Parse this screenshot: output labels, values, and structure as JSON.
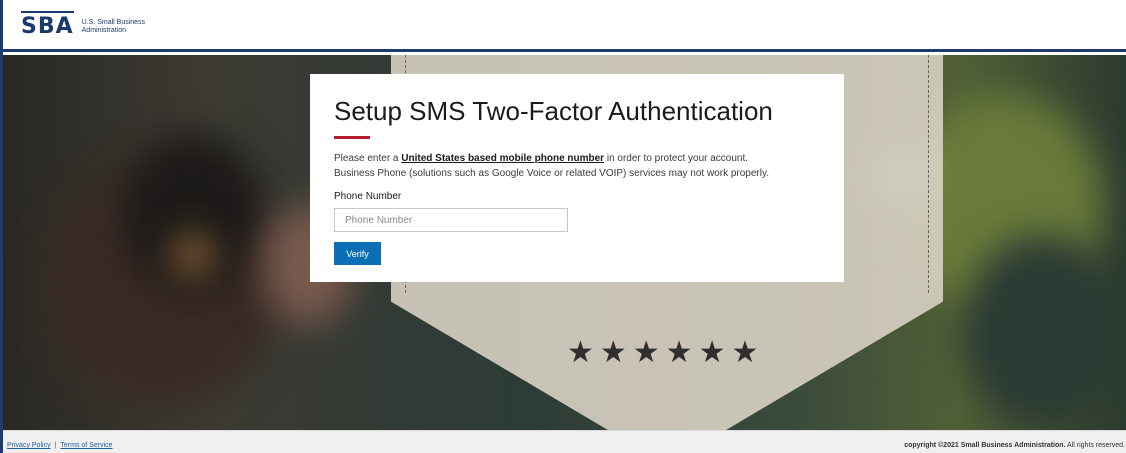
{
  "header": {
    "logo_mark": "SBA",
    "logo_line1": "U.S. Small Business",
    "logo_line2": "Administration"
  },
  "card": {
    "title": "Setup SMS Two-Factor Authentication",
    "intro_prefix": "Please enter a ",
    "intro_link": "United States based mobile phone number",
    "intro_suffix": " in order to protect your account.",
    "intro_line2": "Business Phone (solutions such as Google Voice or related VOIP) services may not work properly.",
    "phone_label": "Phone Number",
    "phone_placeholder": "Phone Number",
    "phone_value": "",
    "verify_label": "Verify"
  },
  "hero": {
    "stars": "★★★★★★"
  },
  "footer": {
    "privacy_label": "Privacy Policy",
    "separator": "|",
    "terms_label": "Terms of Service",
    "copyright_bold": "copyright ©2021 Small Business Administration.",
    "copyright_rest": " All rights reserved."
  },
  "colors": {
    "header_rule": "#1d3b6e",
    "accent_red": "#b51d2c",
    "button_blue": "#0c6fb5"
  }
}
